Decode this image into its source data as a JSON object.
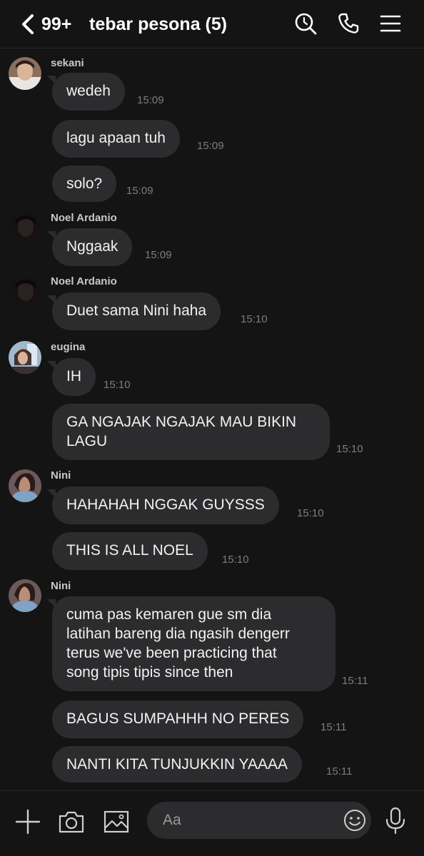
{
  "header": {
    "unread_count": "99+",
    "title": "tebar pesona (5)"
  },
  "senders": {
    "sekani": "sekani",
    "noel_1": "Noel Ardanio",
    "noel_2": "Noel Ardanio",
    "eugina": "eugina",
    "nini_1": "Nini",
    "nini_2": "Nini"
  },
  "messages": [
    {
      "text": "wedeh",
      "time": "15:09"
    },
    {
      "text": "lagu apaan tuh",
      "time": "15:09"
    },
    {
      "text": "solo?",
      "time": "15:09"
    },
    {
      "text": "Nggaak",
      "time": "15:09"
    },
    {
      "text": "Duet sama Nini haha",
      "time": "15:10"
    },
    {
      "text": "IH",
      "time": "15:10"
    },
    {
      "text": "GA NGAJAK NGAJAK MAU BIKIN\nLAGU",
      "time": "15:10"
    },
    {
      "text": "HAHAHAH NGGAK GUYSSS",
      "time": "15:10"
    },
    {
      "text": "THIS IS ALL NOEL",
      "time": "15:10"
    },
    {
      "text": "cuma pas kemaren gue sm dia\nlatihan bareng dia ngasih dengerr\nterus we've been practicing that\nsong tipis tipis since then",
      "time": "15:11"
    },
    {
      "text": "BAGUS SUMPAHHH NO PERES",
      "time": "15:11"
    },
    {
      "text": "NANTI KITA TUNJUKKIN YAAAA",
      "time": "15:11"
    }
  ],
  "composer": {
    "placeholder": "Aa"
  },
  "icons": {
    "back": "chevron-left-icon",
    "search": "search-icon",
    "call": "phone-icon",
    "menu": "menu-icon",
    "plus": "plus-icon",
    "camera": "camera-icon",
    "image": "image-icon",
    "emoji": "emoji-icon",
    "mic": "microphone-icon"
  },
  "colors": {
    "background": "#141414",
    "bubble": "#2c2c2e",
    "text": "#f2f2f2",
    "timestamp": "#7d7d7d"
  }
}
